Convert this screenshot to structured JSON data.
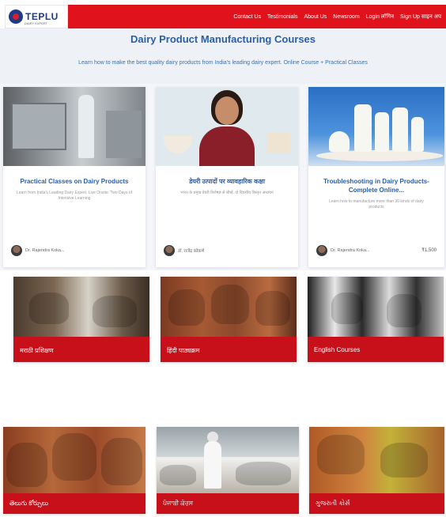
{
  "header": {
    "logo_text": "TEPLU",
    "logo_subtext": "DAIRY EXPERT",
    "nav": [
      "Contact Us",
      "Testimonials",
      "About Us",
      "Newsroom",
      "Login लॉगिन",
      "Sign Up साइन अप"
    ],
    "brand_color": "#e0131c"
  },
  "hero": {
    "title": "Dairy Product Manufacturing Courses",
    "subtitle": "Learn how to make the best quality dairy products from India's leading dairy expert. Online Course + Practical Classes"
  },
  "courses": [
    {
      "title": "Practical Classes on Dairy Products",
      "description": "Learn from India's Leading Dairy Expert. Live Onsite. Two Days of Intensive Learning",
      "author": "Dr. Rajendra Koka...",
      "price": ""
    },
    {
      "title": "डेयरी उत्पादों पर व्यावहारिक कक्षा",
      "description": "भारत के प्रमुख डेयरी विशेषज्ञ से सीखें. दो दिवसीय विस्तृत अध्ययन",
      "author": "डॉ. राजेंद्र कोकणे",
      "price": ""
    },
    {
      "title": "Troubleshooting in Dairy Products- Complete Online...",
      "description": "Learn how to manufacture more than 30 kinds of dairy products",
      "author": "Dr. Rajendra Koka...",
      "price": "₹1,500"
    }
  ],
  "categories": [
    {
      "label": "मराठी प्रशिक्षण"
    },
    {
      "label": "हिंदी पाठ्यक्रम"
    },
    {
      "label": "English Courses"
    },
    {
      "label": "తెలుగు కోర్సులు"
    },
    {
      "label": "ਪੰਜਾਬੀ ਕੋਰਸ"
    },
    {
      "label": "ગુજરાતી કોર્સ"
    }
  ]
}
